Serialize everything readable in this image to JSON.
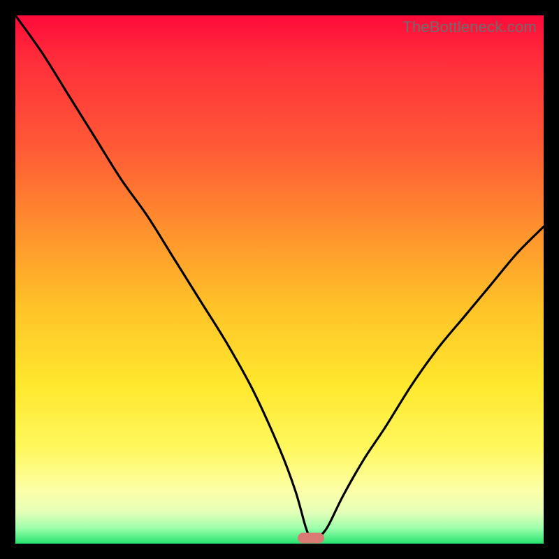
{
  "watermark": "TheBottleneck.com",
  "chart_data": {
    "type": "line",
    "title": "",
    "xlabel": "",
    "ylabel": "",
    "xlim": [
      0,
      100
    ],
    "ylim": [
      0,
      100
    ],
    "grid": false,
    "legend": false,
    "comment": "Bottleneck curve: y is bottleneck percentage, x is relative component performance. Values read from gradient bands; minimum (~0%) near x≈56.",
    "series": [
      {
        "name": "bottleneck-curve",
        "x": [
          0,
          5,
          10,
          15,
          20,
          25,
          30,
          35,
          40,
          45,
          50,
          53,
          55,
          56,
          57,
          59,
          62,
          66,
          70,
          75,
          80,
          85,
          90,
          95,
          100
        ],
        "values": [
          100,
          93,
          85,
          77,
          69,
          62,
          54,
          46,
          38,
          29,
          18,
          10,
          3,
          1,
          1,
          3,
          9,
          16,
          22,
          30,
          37,
          43,
          49,
          55,
          60
        ]
      }
    ],
    "marker": {
      "x": 56,
      "y": 1,
      "shape": "pill",
      "color": "#d97a74"
    },
    "background_gradient": {
      "direction": "vertical",
      "stops": [
        {
          "pct": 0,
          "color": "#ff0a3a"
        },
        {
          "pct": 25,
          "color": "#ff5a36"
        },
        {
          "pct": 55,
          "color": "#ffc228"
        },
        {
          "pct": 82,
          "color": "#fff85e"
        },
        {
          "pct": 94,
          "color": "#e6ffb8"
        },
        {
          "pct": 100,
          "color": "#26e36f"
        }
      ]
    }
  }
}
